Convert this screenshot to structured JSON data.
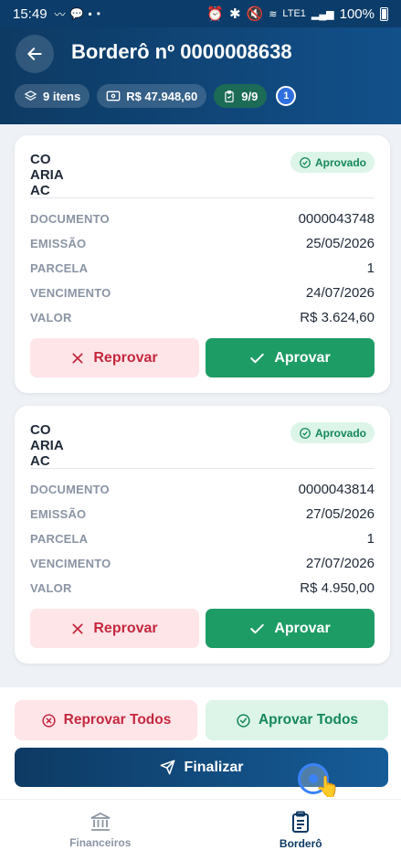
{
  "status_bar": {
    "time": "15:49",
    "battery": "100%",
    "lte": "LTE1"
  },
  "header": {
    "title": "Borderô nº 0000008638",
    "chips": {
      "items": "9 itens",
      "total": "R$ 47.948,60",
      "progress": "9/9",
      "badge": "1"
    }
  },
  "labels": {
    "documento": "DOCUMENTO",
    "emissao": "EMISSÃO",
    "parcela": "PARCELA",
    "vencimento": "VENCIMENTO",
    "valor": "VALOR",
    "reprovar": "Reprovar",
    "aprovar": "Aprovar"
  },
  "cards": [
    {
      "client_line1_left": "CO",
      "client_line1_right": "ARIA",
      "client_line2_left": "AC",
      "status": "Aprovado",
      "documento": "0000043748",
      "emissao": "25/05/2026",
      "parcela": "1",
      "vencimento": "24/07/2026",
      "valor": "R$ 3.624,60"
    },
    {
      "client_line1_left": "CO",
      "client_line1_right": "ARIA",
      "client_line2_left": "AC",
      "status": "Aprovado",
      "documento": "0000043814",
      "emissao": "27/05/2026",
      "parcela": "1",
      "vencimento": "27/07/2026",
      "valor": "R$ 4.950,00"
    }
  ],
  "actions": {
    "reject_all": "Reprovar Todos",
    "approve_all": "Aprovar Todos",
    "finalize": "Finalizar"
  },
  "nav": {
    "financeiros": "Financeiros",
    "bordero": "Borderô",
    "active": "bordero"
  },
  "colors": {
    "primary": "#0d3a63",
    "approve": "#1e9c66",
    "reject": "#c5283f",
    "approved_badge_bg": "#dcf5e8"
  }
}
